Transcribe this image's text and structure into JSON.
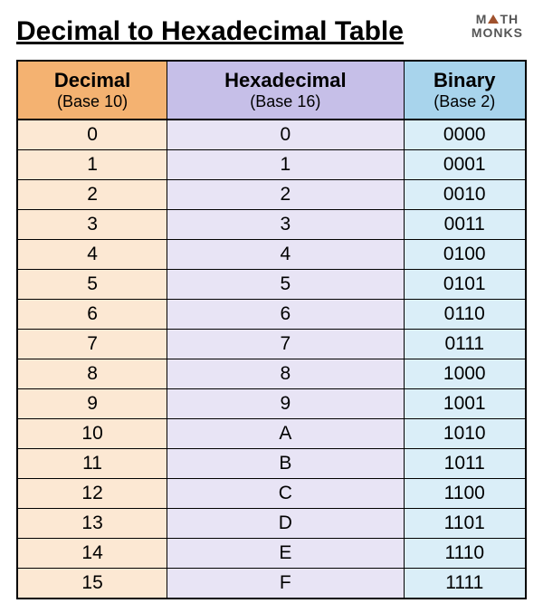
{
  "title": "Decimal to Hexadecimal Table",
  "logo": {
    "line1_pre": "M",
    "line1_post": "TH",
    "line2": "MONKS"
  },
  "columns": [
    {
      "name": "Decimal",
      "base": "(Base 10)"
    },
    {
      "name": "Hexadecimal",
      "base": "(Base 16)"
    },
    {
      "name": "Binary",
      "base": "(Base 2)"
    }
  ],
  "chart_data": {
    "type": "table",
    "title": "Decimal to Hexadecimal Table",
    "columns": [
      "Decimal (Base 10)",
      "Hexadecimal (Base 16)",
      "Binary (Base 2)"
    ],
    "rows": [
      {
        "decimal": "0",
        "hex": "0",
        "binary": "0000"
      },
      {
        "decimal": "1",
        "hex": "1",
        "binary": "0001"
      },
      {
        "decimal": "2",
        "hex": "2",
        "binary": "0010"
      },
      {
        "decimal": "3",
        "hex": "3",
        "binary": "0011"
      },
      {
        "decimal": "4",
        "hex": "4",
        "binary": "0100"
      },
      {
        "decimal": "5",
        "hex": "5",
        "binary": "0101"
      },
      {
        "decimal": "6",
        "hex": "6",
        "binary": "0110"
      },
      {
        "decimal": "7",
        "hex": "7",
        "binary": "0111"
      },
      {
        "decimal": "8",
        "hex": "8",
        "binary": "1000"
      },
      {
        "decimal": "9",
        "hex": "9",
        "binary": "1001"
      },
      {
        "decimal": "10",
        "hex": "A",
        "binary": "1010"
      },
      {
        "decimal": "11",
        "hex": "B",
        "binary": "1011"
      },
      {
        "decimal": "12",
        "hex": "C",
        "binary": "1100"
      },
      {
        "decimal": "13",
        "hex": "D",
        "binary": "1101"
      },
      {
        "decimal": "14",
        "hex": "E",
        "binary": "1110"
      },
      {
        "decimal": "15",
        "hex": "F",
        "binary": "1111"
      }
    ]
  }
}
